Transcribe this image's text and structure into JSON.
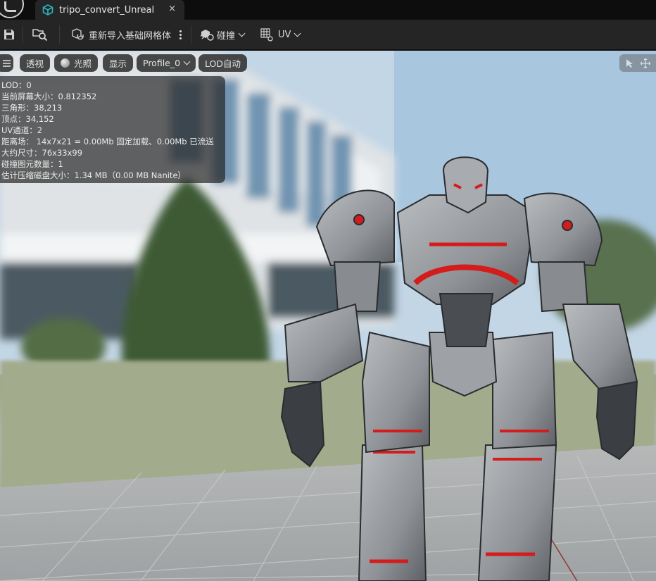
{
  "tab": {
    "title": "tripo_convert_Unreal",
    "close": "×"
  },
  "toolbar": {
    "reimport_label": "重新导入基础网格体",
    "collision_label": "碰撞",
    "uv_label": "UV"
  },
  "viewport_bar": {
    "menu_icon": "hamburger-icon",
    "perspective": "透视",
    "lighting": "光照",
    "show": "显示",
    "profile": "Profile_0",
    "lod": "LOD自动"
  },
  "stats": [
    "LOD：0",
    "当前屏幕大小：0.812352",
    "三角形：38,213",
    "顶点：34,152",
    "UV通道：2",
    "距离场： 14x7x21 = 0.00Mb 固定加载、0.00Mb 已流送",
    "大约尺寸：76x33x99",
    "碰撞图元数量：1",
    "估计压缩磁盘大小：1.34 MB（0.00 MB Nanite）"
  ],
  "colors": {
    "tab_icon": "#2bb5c4",
    "robot_accent": "#d41c1c"
  }
}
